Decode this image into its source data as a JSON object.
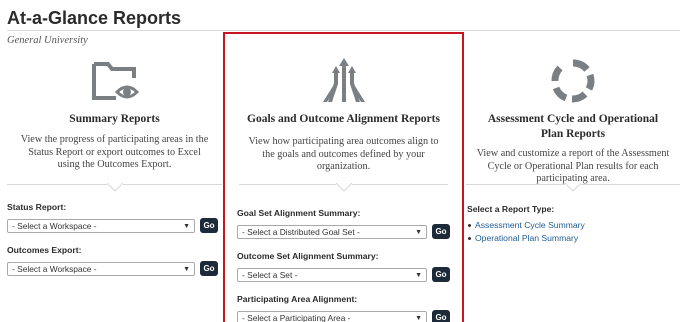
{
  "header": {
    "title": "At-a-Glance Reports",
    "subtitle": "General University"
  },
  "colors": {
    "highlight_border": "#c8141e",
    "icon_gray": "#7a7f84",
    "go_button": "#1c2a3a",
    "link": "#1f5b93"
  },
  "panels": {
    "summary": {
      "icon": "folder-eye-icon",
      "title": "Summary Reports",
      "description": "View the progress of participating areas in the Status Report or export outcomes to Excel using the Outcomes Export.",
      "fields": [
        {
          "label": "Status Report:",
          "value": "- Select a Workspace -",
          "go": "Go"
        },
        {
          "label": "Outcomes Export:",
          "value": "- Select a Workspace -",
          "go": "Go"
        }
      ]
    },
    "alignment": {
      "icon": "converging-arrows-icon",
      "title": "Goals and Outcome Alignment Reports",
      "description": "View how participating area outcomes align to the goals and outcomes defined by your organization.",
      "fields": [
        {
          "label": "Goal Set Alignment Summary:",
          "value": "- Select a Distributed Goal Set -",
          "go": "Go"
        },
        {
          "label": "Outcome Set Alignment Summary:",
          "value": "- Select a Set -",
          "go": "Go"
        },
        {
          "label": "Participating Area Alignment:",
          "value": "- Select a Participating Area -",
          "go": "Go"
        }
      ]
    },
    "cycle": {
      "icon": "cycle-ring-icon",
      "title": "Assessment Cycle and Operational Plan Reports",
      "description": "View and customize a report of the Assessment Cycle or Operational Plan results for each participating area.",
      "report_type_label": "Select a Report Type:",
      "links": [
        "Assessment Cycle Summary",
        "Operational Plan Summary"
      ]
    }
  }
}
